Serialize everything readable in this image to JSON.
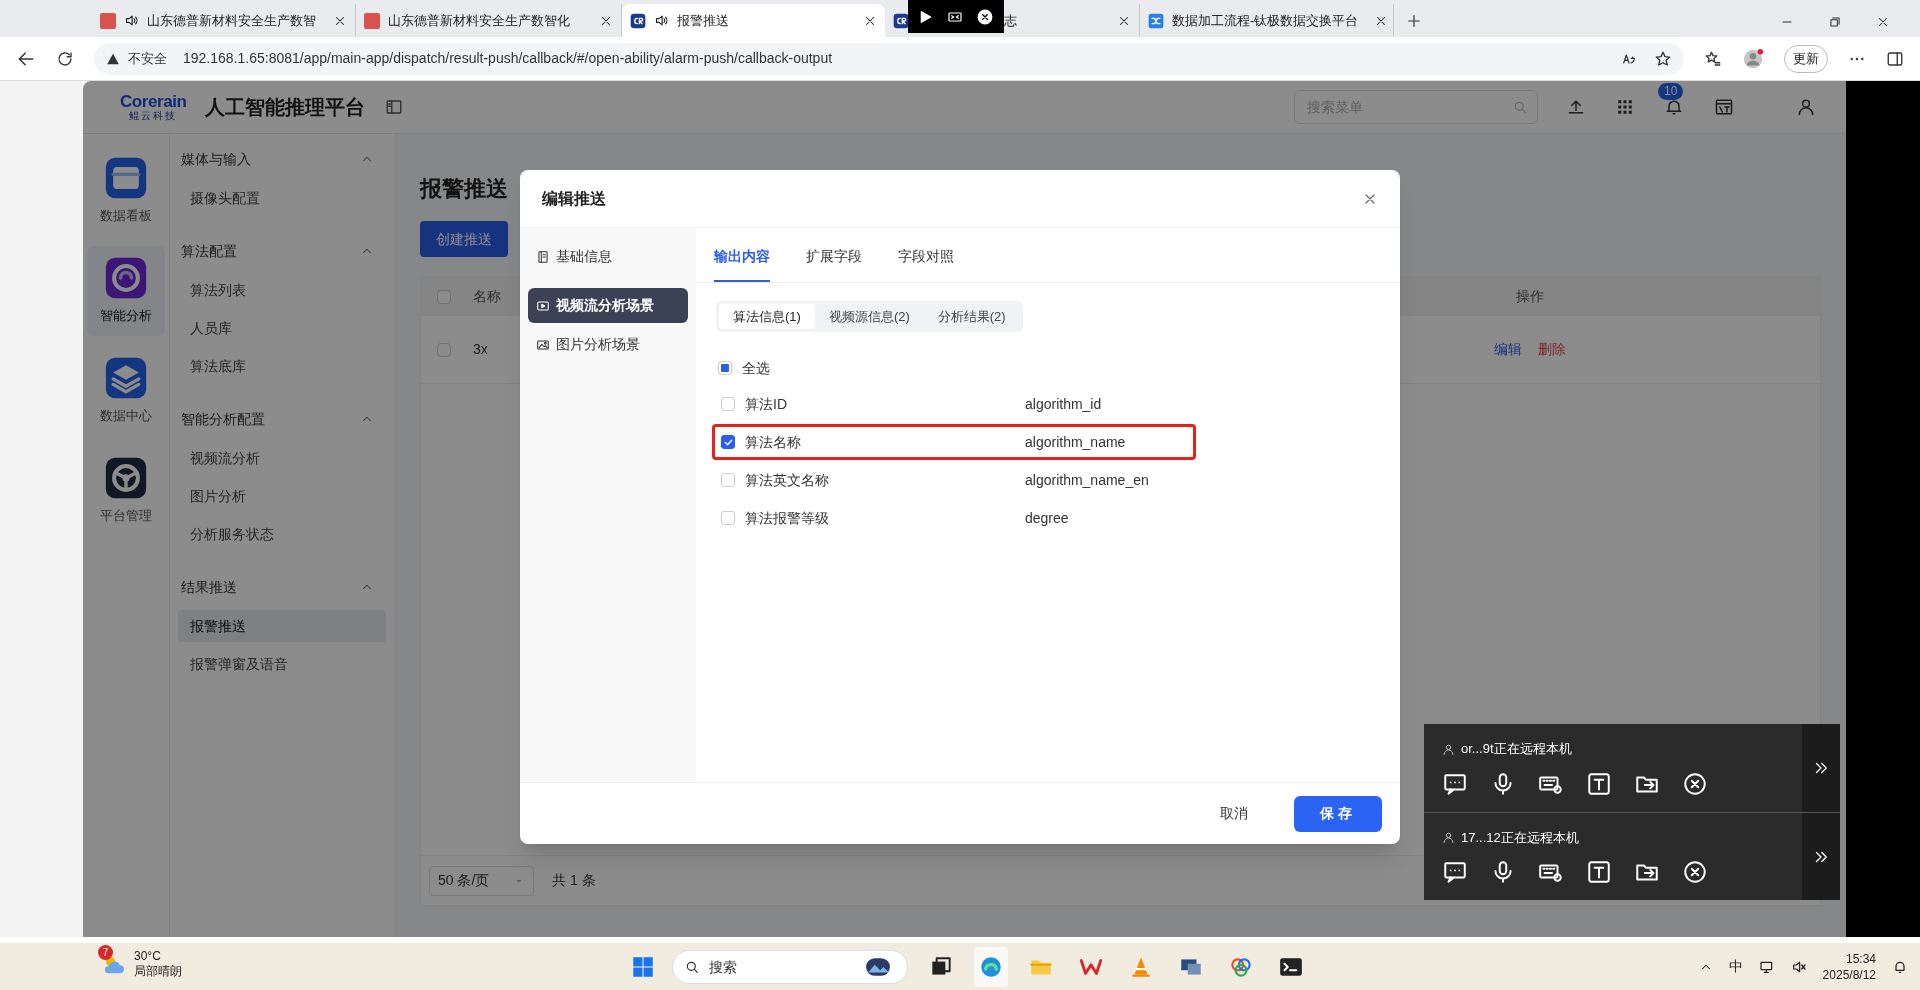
{
  "browser": {
    "tabs": [
      {
        "label": "山东德普新材料安全生产数智",
        "audio": true,
        "selected": false
      },
      {
        "label": "山东德普新材料安全生产数智化",
        "audio": false,
        "selected": false
      },
      {
        "label": "报警推送",
        "audio": true,
        "selected": true
      },
      {
        "label": "志",
        "audio": false,
        "selected": false
      },
      {
        "label": "数据加工流程-钛极数据交换平台",
        "audio": false,
        "selected": false
      }
    ],
    "security": "不安全",
    "url": "192.168.1.65:8081/app/main-app/dispatch/result-push/callback/#/open-ability/alarm-push/callback-output",
    "update_button": "更新"
  },
  "app": {
    "logo": {
      "name": "Corerain",
      "sub": "鲲云科技"
    },
    "title": "人工智能推理平台",
    "search": {
      "placeholder": "搜索菜单"
    },
    "notifications": "10",
    "rail": [
      {
        "label": "数据看板",
        "selected": false
      },
      {
        "label": "智能分析",
        "selected": true
      },
      {
        "label": "数据中心",
        "selected": false
      },
      {
        "label": "平台管理",
        "selected": false
      }
    ],
    "menu": [
      {
        "title": "媒体与输入",
        "expanded": true,
        "items": [
          {
            "label": "摄像头配置",
            "selected": false
          }
        ]
      },
      {
        "title": "算法配置",
        "expanded": true,
        "items": [
          {
            "label": "算法列表",
            "selected": false
          },
          {
            "label": "人员库",
            "selected": false
          },
          {
            "label": "算法底库",
            "selected": false
          }
        ]
      },
      {
        "title": "智能分析配置",
        "expanded": true,
        "items": [
          {
            "label": "视频流分析",
            "selected": false
          },
          {
            "label": "图片分析",
            "selected": false
          },
          {
            "label": "分析服务状态",
            "selected": false
          }
        ]
      },
      {
        "title": "结果推送",
        "expanded": true,
        "items": [
          {
            "label": "报警推送",
            "selected": true
          },
          {
            "label": "报警弹窗及语音",
            "selected": false
          }
        ]
      }
    ],
    "page": {
      "title": "报警推送",
      "create_button": "创建推送",
      "table": {
        "all_checked": false,
        "columns": [
          "名称",
          "操作"
        ],
        "rows": [
          {
            "name": "3x",
            "checked": false,
            "actions": [
              {
                "label": "编辑",
                "kind": "edit"
              },
              {
                "label": "删除",
                "kind": "delete"
              }
            ]
          }
        ]
      },
      "pagination": {
        "page_size": "50 条/页",
        "total": "共 1 条"
      }
    }
  },
  "modal": {
    "title": "编辑推送",
    "nav": [
      {
        "label": "基础信息",
        "selected": false
      },
      {
        "label": "视频流分析场景",
        "selected": true
      },
      {
        "label": "图片分析场景",
        "selected": false
      }
    ],
    "tabs": [
      {
        "label": "输出内容",
        "selected": true
      },
      {
        "label": "扩展字段",
        "selected": false
      },
      {
        "label": "字段对照",
        "selected": false
      }
    ],
    "segments": [
      {
        "label": "算法信息(1)",
        "selected": true
      },
      {
        "label": "视频源信息(2)",
        "selected": false
      },
      {
        "label": "分析结果(2)",
        "selected": false
      }
    ],
    "select_all": {
      "label": "全选",
      "checked": false,
      "indeterminate": true
    },
    "fields": [
      {
        "label": "算法ID",
        "key": "algorithm_id",
        "checked": false,
        "highlighted": false
      },
      {
        "label": "算法名称",
        "key": "algorithm_name",
        "checked": true,
        "highlighted": true
      },
      {
        "label": "算法英文名称",
        "key": "algorithm_name_en",
        "checked": false,
        "highlighted": false
      },
      {
        "label": "算法报警等级",
        "key": "degree",
        "checked": false,
        "highlighted": false
      }
    ],
    "cancel": "取消",
    "save": "保存"
  },
  "remote_sessions": [
    {
      "user": "or...9t正在远程本机"
    },
    {
      "user": "17...12正在远程本机"
    }
  ],
  "taskbar": {
    "weather": {
      "badge": "7",
      "temp": "30°C",
      "desc": "局部晴朗"
    },
    "search": {
      "placeholder": "搜索"
    },
    "ime": "中",
    "time": "15:34",
    "date": "2025/8/12"
  }
}
